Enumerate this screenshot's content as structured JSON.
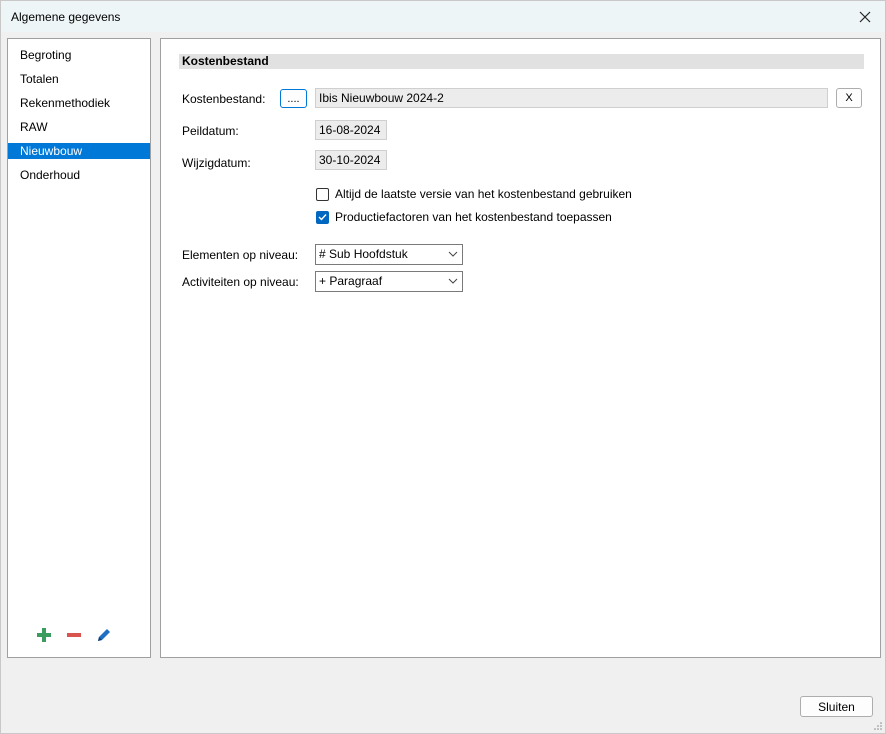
{
  "window": {
    "title": "Algemene gegevens"
  },
  "sidebar": {
    "items": [
      {
        "label": "Begroting",
        "selected": false
      },
      {
        "label": "Totalen",
        "selected": false
      },
      {
        "label": "Rekenmethodiek",
        "selected": false
      },
      {
        "label": "RAW",
        "selected": false
      },
      {
        "label": "Nieuwbouw",
        "selected": true
      },
      {
        "label": "Onderhoud",
        "selected": false
      }
    ],
    "toolbar_icons": [
      "plus-icon",
      "minus-icon",
      "pencil-icon"
    ]
  },
  "main": {
    "section_title": "Kostenbestand",
    "kostenbestand": {
      "label": "Kostenbestand:",
      "browse_label": "....",
      "value": "Ibis Nieuwbouw 2024-2",
      "clear_label": "X"
    },
    "peildatum": {
      "label": "Peildatum:",
      "value": "16-08-2024"
    },
    "wijzigdatum": {
      "label": "Wijzigdatum:",
      "value": "30-10-2024"
    },
    "checkboxes": [
      {
        "label": "Altijd de laatste versie van het kostenbestand gebruiken",
        "checked": false
      },
      {
        "label": "Productiefactoren van het kostenbestand toepassen",
        "checked": true
      }
    ],
    "elementen": {
      "label": "Elementen op niveau:",
      "value": "# Sub Hoofdstuk"
    },
    "activiteiten": {
      "label": "Activiteiten op niveau:",
      "value": "+ Paragraaf"
    }
  },
  "footer": {
    "close_label": "Sluiten"
  },
  "colors": {
    "accent": "#0078d7",
    "checkbox_checked": "#0067c0",
    "add_green": "#3a9d5d",
    "remove_red": "#d9534f",
    "edit_blue": "#1f6fc5"
  }
}
